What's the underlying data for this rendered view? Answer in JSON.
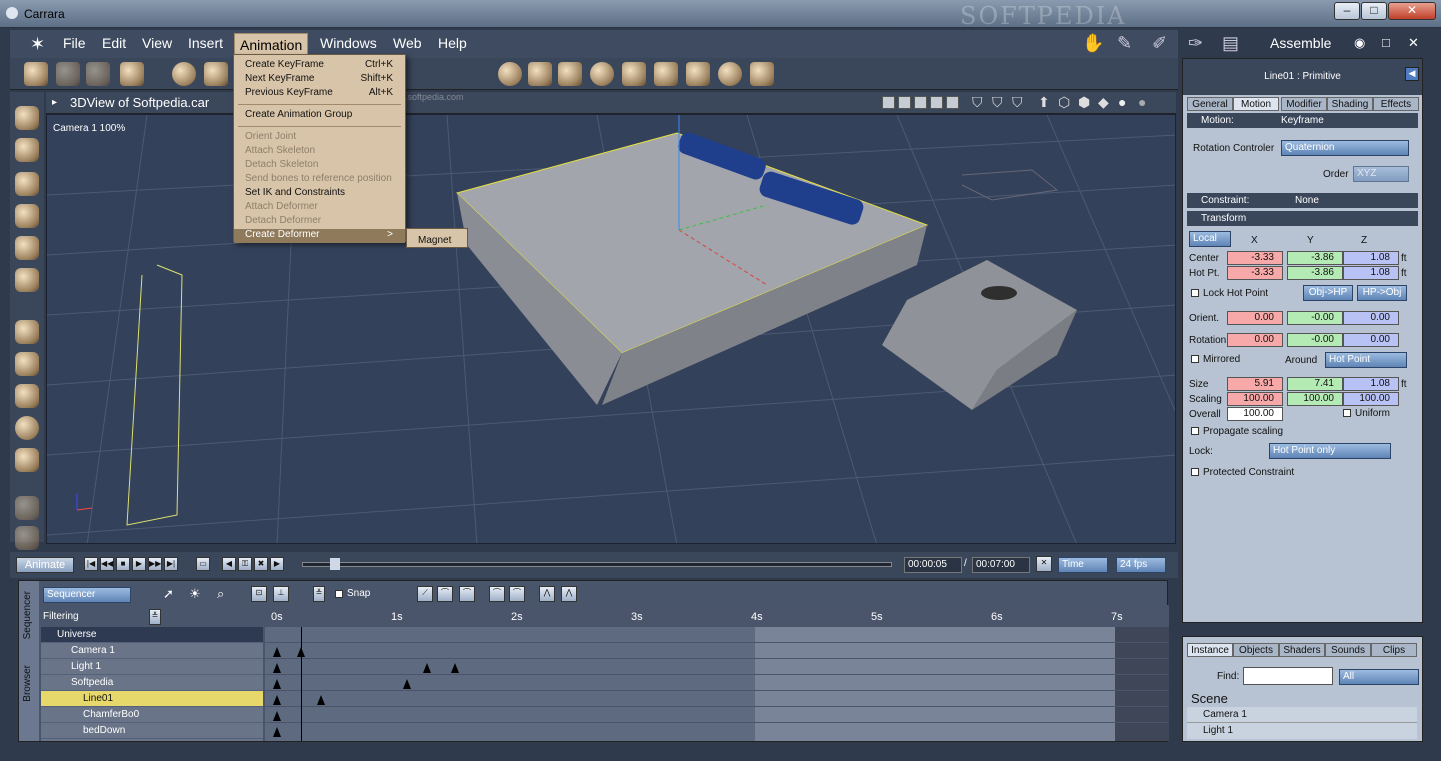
{
  "app": {
    "title": "Carrara",
    "watermark": "SOFTPEDIA",
    "room": "Assemble"
  },
  "menus": [
    "File",
    "Edit",
    "View",
    "Insert",
    "Animation",
    "Windows",
    "Web",
    "Help"
  ],
  "animation_menu": [
    {
      "label": "Create KeyFrame",
      "key": "Ctrl+K",
      "enabled": true
    },
    {
      "label": "Next KeyFrame",
      "key": "Shift+K",
      "enabled": true
    },
    {
      "label": "Previous KeyFrame",
      "key": "Alt+K",
      "enabled": true
    },
    {
      "label": "Create Animation Group",
      "key": "",
      "enabled": true
    },
    {
      "label": "Orient Joint",
      "key": "",
      "enabled": false
    },
    {
      "label": "Attach Skeleton",
      "key": "",
      "enabled": false
    },
    {
      "label": "Detach Skeleton",
      "key": "",
      "enabled": false
    },
    {
      "label": "Send bones to reference position",
      "key": "",
      "enabled": false
    },
    {
      "label": "Set IK and Constraints",
      "key": "",
      "enabled": true
    },
    {
      "label": "Attach Deformer",
      "key": "",
      "enabled": false
    },
    {
      "label": "Detach Deformer",
      "key": "",
      "enabled": false
    },
    {
      "label": "Create Deformer",
      "key": ">",
      "enabled": true
    }
  ],
  "submenu": {
    "item": "Magnet"
  },
  "viewport": {
    "title": "3DView of Softpedia.car",
    "camera": "Camera 1 100%",
    "url": "www.softpedia.com"
  },
  "timeline": {
    "animate": "Animate",
    "current": "00:00:05",
    "total": "00:07:00",
    "mode": "Time",
    "fps": "24 fps"
  },
  "sequencer": {
    "mode": "Sequencer",
    "filtering": "Filtering",
    "snap": "Snap",
    "tabs": [
      "Sequencer",
      "Browser"
    ],
    "ticks": [
      "0s",
      "1s",
      "2s",
      "3s",
      "4s",
      "5s",
      "6s",
      "7s"
    ],
    "rows": [
      "Universe",
      "Camera 1",
      "Light 1",
      "Softpedia",
      "Line01",
      "ChamferBo0",
      "bedDown"
    ]
  },
  "props": {
    "header": "Line01 : Primitive",
    "tabs": [
      "General",
      "Motion",
      "Modifier",
      "Shading",
      "Effects"
    ],
    "motion_label": "Motion:",
    "motion_value": "Keyframe",
    "rot_ctrl_label": "Rotation Controler",
    "rot_ctrl": "Quaternion",
    "order_label": "Order",
    "order": "XYZ",
    "constraint_label": "Constraint:",
    "constraint": "None",
    "transform": "Transform",
    "space": "Local",
    "x": "X",
    "y": "Y",
    "z": "Z",
    "center_label": "Center",
    "center": [
      "-3.33",
      "-3.86",
      "1.08"
    ],
    "hotpt_label": "Hot Pt.",
    "hotpt": [
      "-3.33",
      "-3.86",
      "1.08"
    ],
    "unit": "ft",
    "lock_hp": "Lock Hot Point",
    "obj_hp": "Obj->HP",
    "hp_obj": "HP->Obj",
    "orient_label": "Orient.",
    "orient": [
      "0.00",
      "-0.00",
      "0.00"
    ],
    "rotation_label": "Rotation",
    "rotation": [
      "0.00",
      "-0.00",
      "0.00"
    ],
    "mirrored": "Mirrored",
    "around_label": "Around",
    "around": "Hot Point",
    "size_label": "Size",
    "size": [
      "5.91",
      "7.41",
      "1.08"
    ],
    "scaling_label": "Scaling",
    "scaling": [
      "100.00",
      "100.00",
      "100.00"
    ],
    "overall_label": "Overall",
    "overall": "100.00",
    "uniform": "Uniform",
    "propagate": "Propagate scaling",
    "lock_label": "Lock:",
    "lock": "Hot Point only",
    "protected": "Protected Constraint"
  },
  "browser": {
    "tabs": [
      "Instance",
      "Objects",
      "Shaders",
      "Sounds",
      "Clips"
    ],
    "find": "Find:",
    "filter": "All",
    "scene": "Scene",
    "items": [
      "Camera 1",
      "Light 1"
    ]
  }
}
